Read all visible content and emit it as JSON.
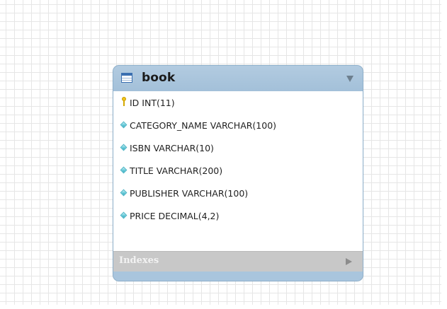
{
  "entity": {
    "title": "book",
    "icon": "table-icon",
    "columns": [
      {
        "label": "ID INT(11)",
        "icon": "primary-key-icon"
      },
      {
        "label": "CATEGORY_NAME VARCHAR(100)",
        "icon": "column-diamond-icon"
      },
      {
        "label": "ISBN VARCHAR(10)",
        "icon": "column-diamond-icon"
      },
      {
        "label": "TITLE VARCHAR(200)",
        "icon": "column-diamond-icon"
      },
      {
        "label": "PUBLISHER VARCHAR(100)",
        "icon": "column-diamond-icon"
      },
      {
        "label": "PRICE DECIMAL(4,2)",
        "icon": "column-diamond-icon"
      }
    ],
    "indexes_label": "Indexes"
  },
  "colors": {
    "header": "#a7c4dc",
    "indexes_bar": "#c8c8c8",
    "grid": "#e6e6e6"
  }
}
